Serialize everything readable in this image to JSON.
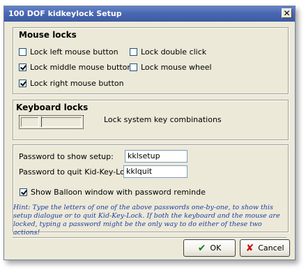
{
  "window": {
    "title": "100 DOF kidkeylock Setup",
    "close_glyph": "✕"
  },
  "mouse_locks": {
    "title": "Mouse locks",
    "items": [
      {
        "label": "Lock left mouse button",
        "checked": false
      },
      {
        "label": "Lock middle mouse button",
        "checked": true
      },
      {
        "label": "Lock right mouse button",
        "checked": true
      },
      {
        "label": "Lock double click",
        "checked": false
      },
      {
        "label": "Lock mouse wheel",
        "checked": false
      }
    ]
  },
  "keyboard_locks": {
    "title": "Keyboard locks",
    "slider_label": "Lock system key combinations",
    "slider_level": 0.3
  },
  "passwords": {
    "setup_label": "Password to show setup:",
    "setup_value": "kklsetup",
    "quit_label": "Password to quit Kid-Key-Lock:",
    "quit_value": "kklquit",
    "balloon_label": "Show Balloon window with password reminde",
    "balloon_checked": true,
    "hint": "Hint: Type the letters of one of the above passwords one-by-one, to show this setup dialogue or to quit Kid-Key-Lock. If both the keyboard and the mouse are locked, typing a password might be the only way to do either of these two actions!"
  },
  "buttons": {
    "ok_label": "OK",
    "ok_icon": "✔",
    "ok_icon_color": "#1a7a1a",
    "cancel_label": "Cancel",
    "cancel_icon": "✘",
    "cancel_icon_color": "#c0161b"
  }
}
